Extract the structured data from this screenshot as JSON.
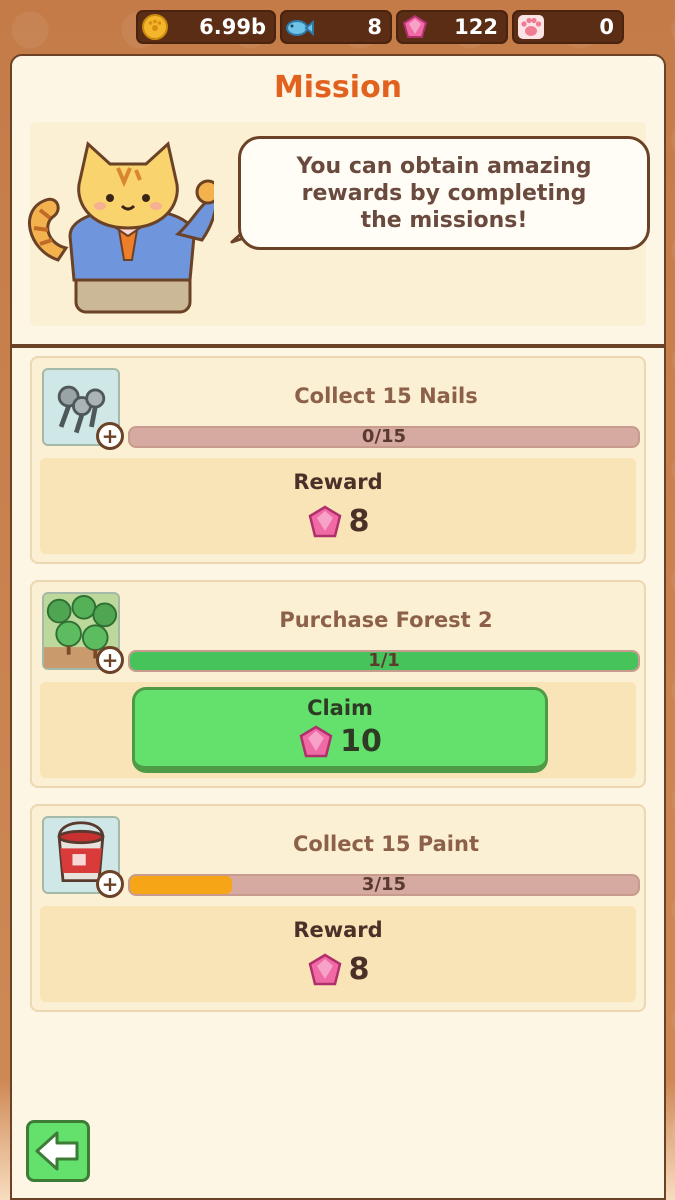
{
  "currencies": [
    {
      "name": "coin",
      "value": "6.99b",
      "icon": "coin-icon"
    },
    {
      "name": "fish",
      "value": "8",
      "icon": "fish-icon"
    },
    {
      "name": "gem",
      "value": "122",
      "icon": "gem-icon"
    },
    {
      "name": "paw",
      "value": "0",
      "icon": "paw-icon"
    }
  ],
  "panel": {
    "title": "Mission",
    "speech": "You can obtain amazing rewards by completing the missions!"
  },
  "missions": [
    {
      "title": "Collect 15 Nails",
      "progress_text": "0/15",
      "progress": 0.0,
      "reward_label": "Reward",
      "reward_value": "8",
      "state": "reward",
      "icon": "nails-icon"
    },
    {
      "title": "Purchase Forest 2",
      "progress_text": "1/1",
      "progress": 1.0,
      "claim_label": "Claim",
      "reward_value": "10",
      "state": "claim",
      "icon": "forest-icon"
    },
    {
      "title": "Collect 15 Paint",
      "progress_text": "3/15",
      "progress": 0.2,
      "reward_label": "Reward",
      "reward_value": "8",
      "state": "reward",
      "icon": "paint-bucket-icon"
    }
  ],
  "colors": {
    "accent": "#e1621e",
    "progress_green": "#46c35a",
    "progress_orange": "#f6a516",
    "gem": "#f06aa6"
  },
  "back_button_icon": "back-arrow-icon"
}
